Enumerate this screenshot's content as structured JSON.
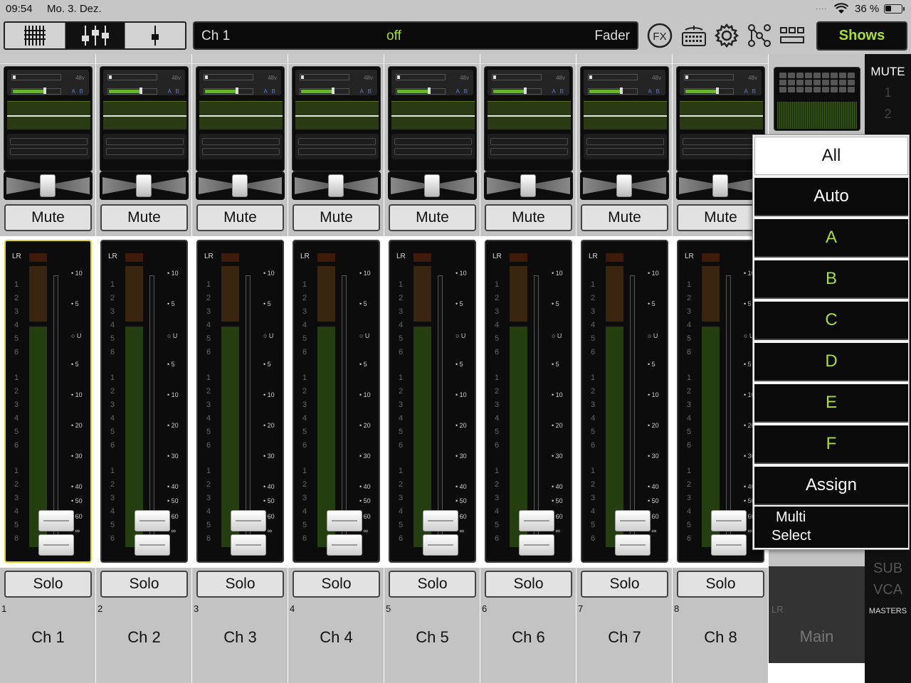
{
  "status": {
    "time": "09:54",
    "date": "Mo. 3. Dez.",
    "signal": "....",
    "wifi": "wifi-icon",
    "battery": "36 %"
  },
  "toolbar": {
    "channel_name": "Ch 1",
    "channel_state": "off",
    "channel_mode": "Fader",
    "shows_label": "Shows",
    "icons": [
      "fx-icon",
      "keyboard-icon",
      "gear-icon",
      "routing-icon",
      "patch-icon"
    ],
    "fx_text": "FX"
  },
  "channels": [
    {
      "num": "1",
      "name": "Ch 1",
      "mute": "Mute",
      "solo": "Solo",
      "selected": true
    },
    {
      "num": "2",
      "name": "Ch 2",
      "mute": "Mute",
      "solo": "Solo",
      "selected": false
    },
    {
      "num": "3",
      "name": "Ch 3",
      "mute": "Mute",
      "solo": "Solo",
      "selected": false
    },
    {
      "num": "4",
      "name": "Ch 4",
      "mute": "Mute",
      "solo": "Solo",
      "selected": false
    },
    {
      "num": "5",
      "name": "Ch 5",
      "mute": "Mute",
      "solo": "Solo",
      "selected": false
    },
    {
      "num": "6",
      "name": "Ch 6",
      "mute": "Mute",
      "solo": "Solo",
      "selected": false
    },
    {
      "num": "7",
      "name": "Ch 7",
      "mute": "Mute",
      "solo": "Solo",
      "selected": false
    },
    {
      "num": "8",
      "name": "Ch 8",
      "mute": "Mute",
      "solo": "Solo",
      "selected": false
    }
  ],
  "strip_labels": {
    "phantom": "48v",
    "ab": "A B",
    "bus": "LR",
    "scale": [
      "10",
      "5",
      "U",
      "5",
      "10",
      "20",
      "30",
      "40",
      "50",
      "60",
      "∞"
    ],
    "meter_numbers": [
      "1",
      "2",
      "3",
      "4",
      "5",
      "6",
      "1",
      "2",
      "3",
      "4",
      "5",
      "6",
      "1",
      "2",
      "3",
      "4",
      "5",
      "6"
    ]
  },
  "main": {
    "bus": "LR",
    "name": "Main"
  },
  "side": {
    "mute": "MUTE",
    "n1": "1",
    "n2": "2",
    "sub": "SUB",
    "vca": "VCA",
    "masters": "MASTERS"
  },
  "mute_groups": {
    "items": [
      "All",
      "Auto",
      "A",
      "B",
      "C",
      "D",
      "E",
      "F",
      "Assign"
    ],
    "multi_line1": "Multi",
    "multi_line2": "Select"
  },
  "colors": {
    "accent": "#a8e02c",
    "selected_border": "#e0d524",
    "fader_green": "#243e10"
  }
}
